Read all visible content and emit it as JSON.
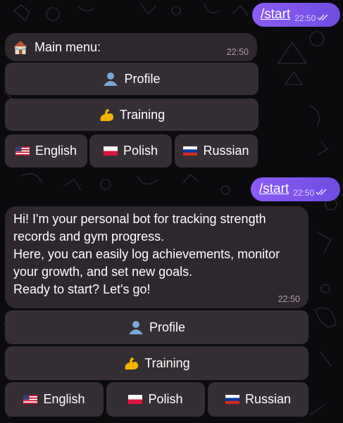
{
  "messages": {
    "out1": {
      "command": "/start",
      "time": "22:50"
    },
    "menu": {
      "title": "Main menu:",
      "time": "22:50",
      "icon": "house-icon"
    },
    "out2": {
      "command": "/start",
      "time": "22:50"
    },
    "welcome": {
      "text": "Hi! I'm your personal bot for tracking strength records and gym progress.\nHere, you can easily log achievements, monitor your growth, and set new goals.\nReady to start? Let's go!",
      "time": "22:50"
    }
  },
  "keyboard": {
    "profile": "Profile",
    "training": "Training",
    "english": "English",
    "polish": "Polish",
    "russian": "Russian",
    "icons": {
      "profile": "user-silhouette-icon",
      "training": "flexed-biceps-icon",
      "english": "us-flag-icon",
      "polish": "poland-flag-icon",
      "russian": "russia-flag-icon"
    }
  },
  "colors": {
    "out_bubble": "#8b5cf6",
    "in_bubble": "#30282e",
    "button": "#373036",
    "background": "#0b0b0e"
  }
}
